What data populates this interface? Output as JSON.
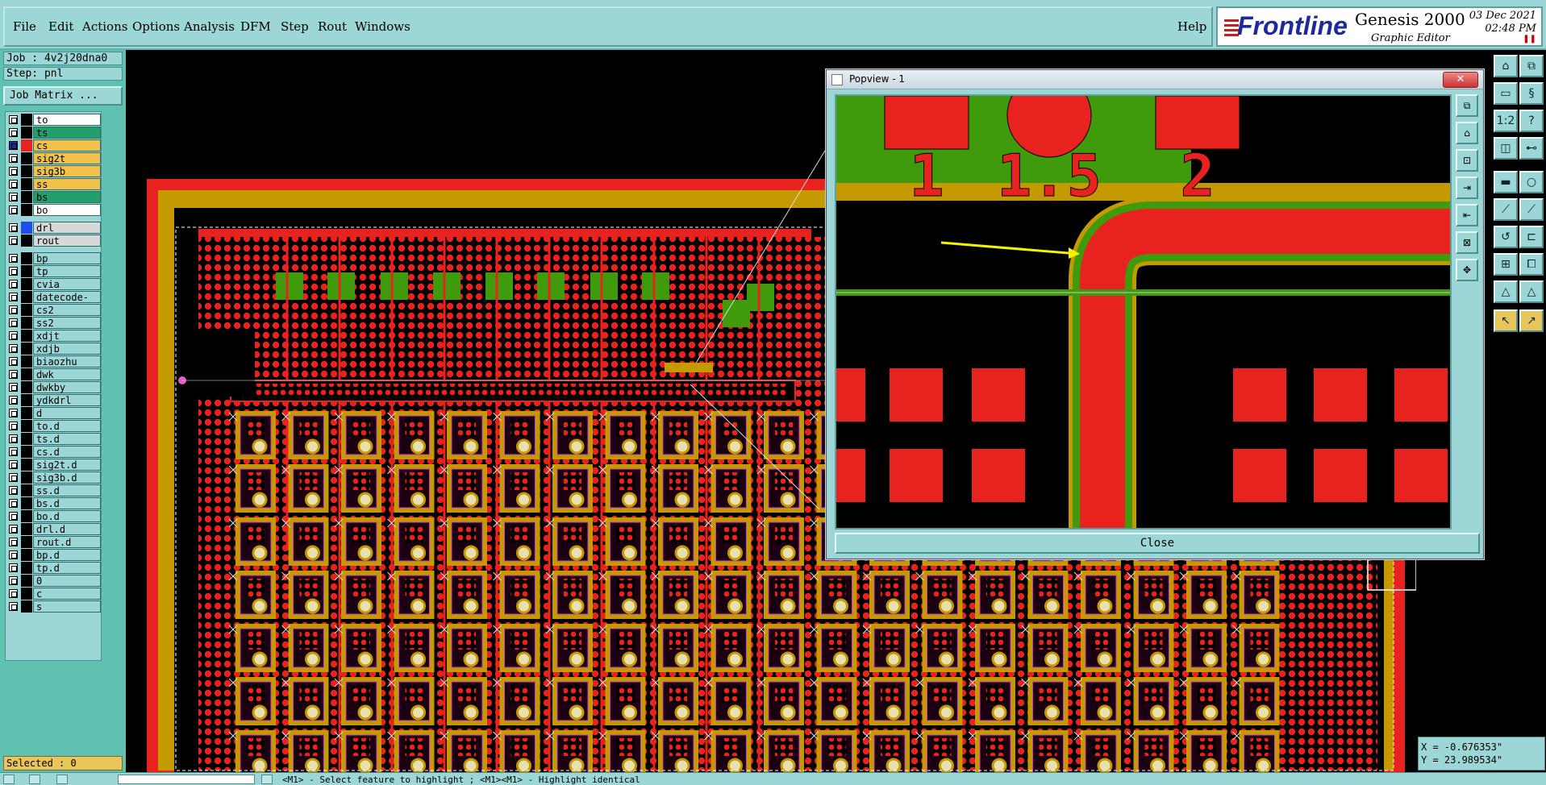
{
  "menu": {
    "items": [
      "File",
      "Edit",
      "Actions",
      "Options",
      "Analysis",
      "DFM",
      "Step",
      "Rout",
      "Windows"
    ],
    "help": "Help"
  },
  "brand": {
    "logo": "Frontline",
    "product": "Genesis 2000",
    "subtitle": "Graphic Editor",
    "date": "03 Dec 2021",
    "time": "02:48 PM"
  },
  "job": {
    "job_line": "Job : 4v2j20dna0",
    "step_line": "Step: pnl",
    "matrix_button": "Job Matrix ..."
  },
  "layers": [
    {
      "name": "to",
      "swatch": "#000000",
      "bg": "#ffffff"
    },
    {
      "name": "ts",
      "swatch": "#000000",
      "bg": "#22a06b"
    },
    {
      "name": "cs",
      "swatch": "#e8231f",
      "bg": "#f0c24a",
      "active": true
    },
    {
      "name": "sig2t",
      "swatch": "#000000",
      "bg": "#f0c24a"
    },
    {
      "name": "sig3b",
      "swatch": "#000000",
      "bg": "#f0c24a"
    },
    {
      "name": "ss",
      "swatch": "#000000",
      "bg": "#f0c24a"
    },
    {
      "name": "bs",
      "swatch": "#000000",
      "bg": "#22a06b"
    },
    {
      "name": "bo",
      "swatch": "#000000",
      "bg": "#ffffff"
    },
    {
      "name": "drl",
      "swatch": "#1f4fe8",
      "bg": "#d8d8d8",
      "gap": true
    },
    {
      "name": "rout",
      "swatch": "#000000",
      "bg": "#d8d8d8"
    },
    {
      "name": "bp",
      "swatch": "#000000",
      "bg": "#9cd6d6",
      "gap": true
    },
    {
      "name": "tp",
      "swatch": "#000000",
      "bg": "#9cd6d6"
    },
    {
      "name": "cvia",
      "swatch": "#000000",
      "bg": "#9cd6d6"
    },
    {
      "name": "datecode-pbe",
      "swatch": "#000000",
      "bg": "#9cd6d6"
    },
    {
      "name": "cs2",
      "swatch": "#000000",
      "bg": "#9cd6d6"
    },
    {
      "name": "ss2",
      "swatch": "#000000",
      "bg": "#9cd6d6"
    },
    {
      "name": "xdjt",
      "swatch": "#000000",
      "bg": "#9cd6d6"
    },
    {
      "name": "xdjb",
      "swatch": "#000000",
      "bg": "#9cd6d6"
    },
    {
      "name": "biaozhu",
      "swatch": "#000000",
      "bg": "#9cd6d6"
    },
    {
      "name": "dwk",
      "swatch": "#000000",
      "bg": "#9cd6d6"
    },
    {
      "name": "dwkby",
      "swatch": "#000000",
      "bg": "#9cd6d6"
    },
    {
      "name": "ydkdrl",
      "swatch": "#000000",
      "bg": "#9cd6d6"
    },
    {
      "name": "d",
      "swatch": "#000000",
      "bg": "#9cd6d6"
    },
    {
      "name": "to.d",
      "swatch": "#000000",
      "bg": "#9cd6d6"
    },
    {
      "name": "ts.d",
      "swatch": "#000000",
      "bg": "#9cd6d6"
    },
    {
      "name": "cs.d",
      "swatch": "#000000",
      "bg": "#9cd6d6"
    },
    {
      "name": "sig2t.d",
      "swatch": "#000000",
      "bg": "#9cd6d6"
    },
    {
      "name": "sig3b.d",
      "swatch": "#000000",
      "bg": "#9cd6d6"
    },
    {
      "name": "ss.d",
      "swatch": "#000000",
      "bg": "#9cd6d6"
    },
    {
      "name": "bs.d",
      "swatch": "#000000",
      "bg": "#9cd6d6"
    },
    {
      "name": "bo.d",
      "swatch": "#000000",
      "bg": "#9cd6d6"
    },
    {
      "name": "drl.d",
      "swatch": "#000000",
      "bg": "#9cd6d6"
    },
    {
      "name": "rout.d",
      "swatch": "#000000",
      "bg": "#9cd6d6"
    },
    {
      "name": "bp.d",
      "swatch": "#000000",
      "bg": "#9cd6d6"
    },
    {
      "name": "tp.d",
      "swatch": "#000000",
      "bg": "#9cd6d6"
    },
    {
      "name": "0",
      "swatch": "#000000",
      "bg": "#9cd6d6"
    },
    {
      "name": "c",
      "swatch": "#000000",
      "bg": "#9cd6d6"
    },
    {
      "name": "s",
      "swatch": "#000000",
      "bg": "#9cd6d6"
    }
  ],
  "selection": {
    "text": "Selected : 0"
  },
  "coords": {
    "x": "X = -0.676353\"",
    "y": "Y = 23.989534\""
  },
  "status": {
    "message": "<M1> - Select feature to highlight ; <M1><M1> - Highlight identical"
  },
  "popview": {
    "title": "Popview - 1",
    "close_x": "✕",
    "close_button": "Close",
    "labels": [
      "1",
      "1.5",
      "2"
    ]
  },
  "colors": {
    "copper": "#e8231f",
    "mask": "#3f9a0c",
    "outline": "#c49a00",
    "panel": "#9cd6d6",
    "sidebar": "#5fc1b0"
  },
  "icons": {
    "right_toolbar": [
      "home-icon",
      "zoom-icon",
      "step-icon",
      "help-icon",
      "layers-icon",
      "snap-icon",
      "measure-icon",
      "select-icon",
      "route-icon",
      "pad-icon",
      "warning-icon",
      "pointer-icon"
    ]
  }
}
